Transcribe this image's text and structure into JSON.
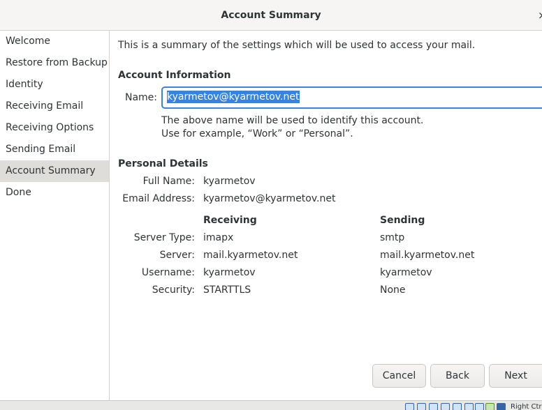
{
  "window": {
    "title": "Account Summary",
    "close_glyph": "×"
  },
  "sidebar": {
    "items": [
      {
        "label": "Welcome"
      },
      {
        "label": "Restore from Backup"
      },
      {
        "label": "Identity"
      },
      {
        "label": "Receiving Email"
      },
      {
        "label": "Receiving Options"
      },
      {
        "label": "Sending Email"
      },
      {
        "label": "Account Summary",
        "active": true
      },
      {
        "label": "Done"
      }
    ]
  },
  "main": {
    "intro": "This is a summary of the settings which will be used to access your mail.",
    "account_info": {
      "heading": "Account Information",
      "name_label": "Name:",
      "name_value": "kyarmetov@kyarmetov.net",
      "hint_line1": "The above name will be used to identify this account.",
      "hint_line2": "Use for example, “Work” or “Personal”."
    },
    "personal": {
      "heading": "Personal Details",
      "full_name_label": "Full Name:",
      "full_name": "kyarmetov",
      "email_label": "Email Address:",
      "email": "kyarmetov@kyarmetov.net"
    },
    "servers": {
      "receiving_heading": "Receiving",
      "sending_heading": "Sending",
      "rows": [
        {
          "label": "Server Type:",
          "receiving": "imapx",
          "sending": "smtp"
        },
        {
          "label": "Server:",
          "receiving": "mail.kyarmetov.net",
          "sending": "mail.kyarmetov.net"
        },
        {
          "label": "Username:",
          "receiving": "kyarmetov",
          "sending": "kyarmetov"
        },
        {
          "label": "Security:",
          "receiving": "STARTTLS",
          "sending": "None"
        }
      ]
    }
  },
  "buttons": {
    "cancel": "Cancel",
    "back": "Back",
    "next": "Next"
  },
  "statusbar": {
    "host_key": "Right Ctrl"
  }
}
